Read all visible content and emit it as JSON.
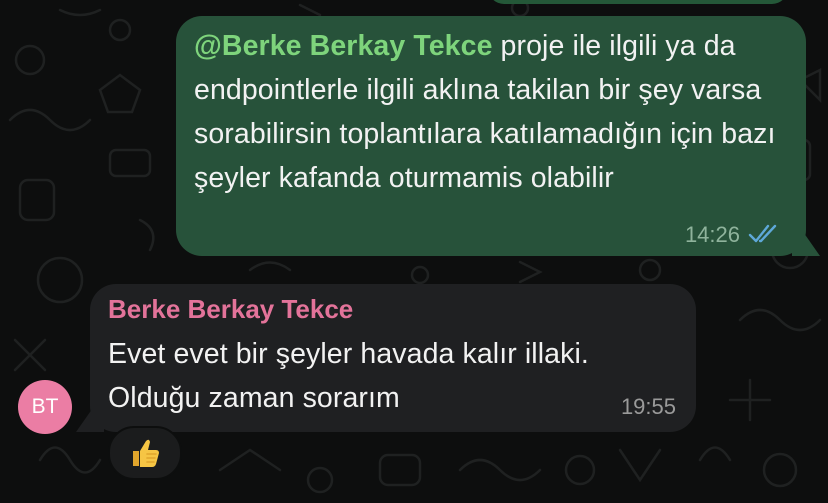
{
  "messages": {
    "outgoing": {
      "mention": "@Berke Berkay Tekce",
      "text": " proje ile ilgili ya da endpointlerle ilgili aklına takilan bir şey varsa sorabilirsin toplantılara katılamadığın için bazı şeyler kafanda oturmamis olabilir",
      "time": "14:26",
      "status_icon": "double-check-icon"
    },
    "incoming": {
      "sender": "Berke Berkay Tekce",
      "text": "Evet evet bir şeyler havada kalır illaki. Olduğu zaman sorarım",
      "time": "19:55",
      "avatar_initials": "BT",
      "reaction_icon": "thumbs-up-icon"
    }
  },
  "colors": {
    "outgoing_bubble": "#27523a",
    "incoming_bubble": "#1f2022",
    "mention": "#7ed47c",
    "sender_name": "#e3739a",
    "avatar": "#eb7da4",
    "read_check": "#5ea8d8"
  }
}
